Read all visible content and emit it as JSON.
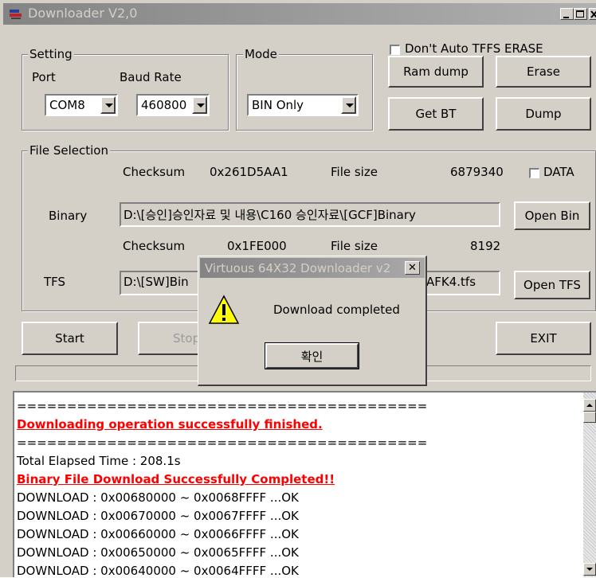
{
  "window": {
    "title": "Downloader V2,0"
  },
  "setting": {
    "group_label": "Setting",
    "port_label": "Port",
    "baud_label": "Baud Rate",
    "port_value": "COM8",
    "baud_value": "460800"
  },
  "mode": {
    "group_label": "Mode",
    "value": "BIN Only"
  },
  "options": {
    "dont_auto_tffs_erase": "Don't Auto TFFS ERASE"
  },
  "buttons": {
    "ram_dump": "Ram dump",
    "erase": "Erase",
    "get_bt": "Get BT",
    "dump": "Dump",
    "open_bin": "Open Bin",
    "open_tfs": "Open TFS",
    "start": "Start",
    "stop": "Stop",
    "exit": "EXIT"
  },
  "file_selection": {
    "group_label": "File Selection",
    "checksum_label": "Checksum",
    "filesize_label": "File size",
    "data_label": "DATA",
    "binary_label": "Binary",
    "tfs_label": "TFS",
    "binary_checksum": "0x261D5AA1",
    "binary_size": "6879340",
    "binary_path": "D:\\[승인]승인자료 및 내용\\C160 승인자료\\[GCF]Binary",
    "tfs_checksum": "0x1FE000",
    "tfs_size": "8192",
    "tfs_path_start": "D:\\[SW]Bin",
    "tfs_path_end": "AFK4.tfs"
  },
  "dialog": {
    "title": "Virtuous 64X32 Downloader v2",
    "message": "Download completed",
    "ok_label": "확인"
  },
  "log": {
    "lines": [
      {
        "text": "=========================================",
        "style": "normal"
      },
      {
        "text": "Downloading operation successfully finished.",
        "style": "red"
      },
      {
        "text": "=========================================",
        "style": "normal"
      },
      {
        "text": "Total Elapsed Time : 208.1s",
        "style": "normal"
      },
      {
        "text": "Binary File Download Successfully Completed!!",
        "style": "red"
      },
      {
        "text": "DOWNLOAD : 0x00680000 ~ 0x0068FFFF ...OK",
        "style": "normal"
      },
      {
        "text": "DOWNLOAD : 0x00670000 ~ 0x0067FFFF ...OK",
        "style": "normal"
      },
      {
        "text": "DOWNLOAD : 0x00660000 ~ 0x0066FFFF ...OK",
        "style": "normal"
      },
      {
        "text": "DOWNLOAD : 0x00650000 ~ 0x0065FFFF ...OK",
        "style": "normal"
      },
      {
        "text": "DOWNLOAD : 0x00640000 ~ 0x0064FFFF ...OK",
        "style": "normal"
      }
    ]
  }
}
